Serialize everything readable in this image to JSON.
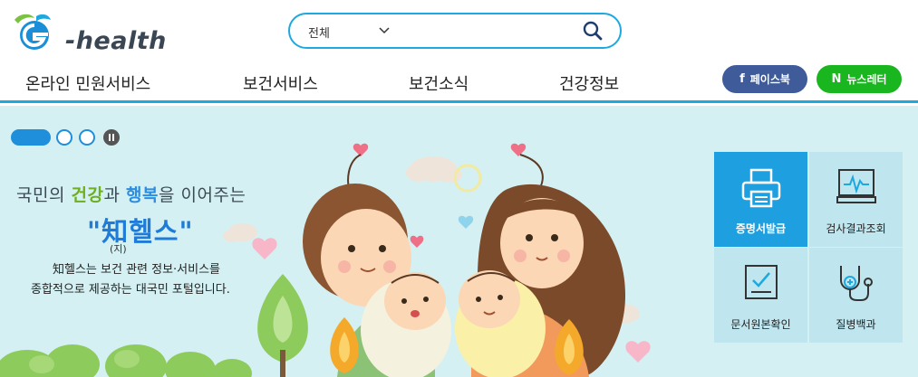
{
  "header": {
    "logo_text": "-health",
    "search": {
      "scope": "전체",
      "placeholder": "",
      "value": ""
    }
  },
  "nav": {
    "items": [
      {
        "label": "온라인 민원서비스"
      },
      {
        "label": "보건서비스"
      },
      {
        "label": "보건소식"
      },
      {
        "label": "건강정보"
      }
    ],
    "social": {
      "facebook": {
        "glyph": "f",
        "label": "페이스북",
        "color": "#3f5b99"
      },
      "newsletter": {
        "glyph": "N",
        "label": "뉴스레터",
        "color": "#19b61f"
      }
    }
  },
  "banner": {
    "tagline": {
      "pre": "국민의 ",
      "health": "건강",
      "mid": "과 ",
      "happy": "행복",
      "post": "을 이어주는"
    },
    "brand_name": "\"知헬스\"",
    "brand_reading": "(지)",
    "desc_line1": "知헬스는 보건 관련 정보·서비스를",
    "desc_line2": "종합적으로 제공하는 대국민 포털입니다.",
    "slider": {
      "slides": 3,
      "active": 1
    }
  },
  "quick_menu": [
    {
      "label": "증명서발급",
      "icon": "printer-icon",
      "active": true
    },
    {
      "label": "검사결과조회",
      "icon": "monitor-icon",
      "active": false
    },
    {
      "label": "문서원본확인",
      "icon": "document-check-icon",
      "active": false
    },
    {
      "label": "질병백과",
      "icon": "stethoscope-icon",
      "active": false
    }
  ],
  "colors": {
    "accent": "#1ea8e0",
    "banner_bg": "#d4f0f3",
    "tile_active": "#1e9fe0",
    "tile": "#bfe6ef"
  }
}
